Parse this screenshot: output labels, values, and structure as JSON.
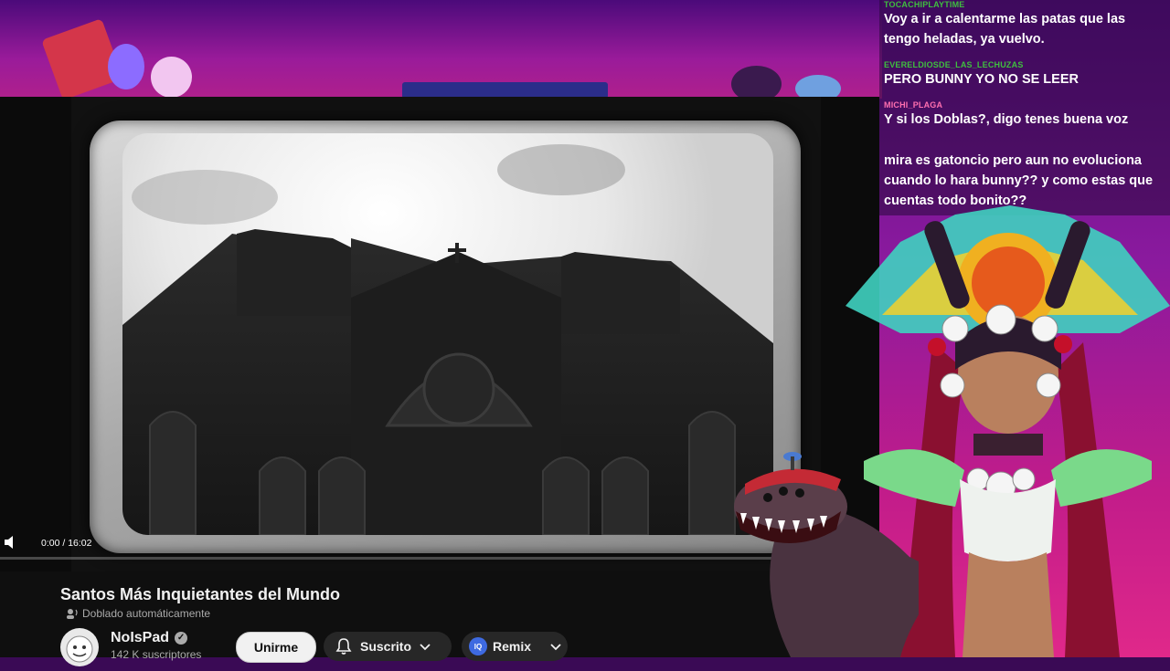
{
  "player": {
    "time": "0:00 / 16:02",
    "progress": 0.0
  },
  "video": {
    "title": "Santos Más Inquietantes del Mundo",
    "dub_label": "Doblado automáticamente"
  },
  "channel": {
    "name": "NoIsPad",
    "subscribers": "142 K suscriptores"
  },
  "buttons": {
    "join": "Unirme",
    "subscribed": "Suscrito",
    "remix": "Remix",
    "remix_badge": "IQ"
  },
  "chat": {
    "messages": [
      {
        "user": "TOCACHIPLAYTIME",
        "user_color": "#3fbf3f",
        "text": "Voy a ir a calentarme las patas que las tengo heladas, ya vuelvo."
      },
      {
        "user": "EVERELDIOSDE_LAS_LECHUZAS",
        "user_color": "#3fbf3f",
        "text": "PERO BUNNY YO NO SE LEER"
      },
      {
        "user": "MICHI_PLAGA",
        "user_color": "#ff6fb0",
        "text": "Y si los Doblas?, digo tenes buena voz"
      },
      {
        "user": "",
        "user_color": "#ff3030",
        "text": "mira es gatoncio pero aun no evoluciona cuando lo hara bunny?? y como estas que cuentas todo bonito??"
      }
    ]
  },
  "colors": {
    "accent_red": "#ff0033",
    "remix_blue": "#3e6ae1"
  }
}
